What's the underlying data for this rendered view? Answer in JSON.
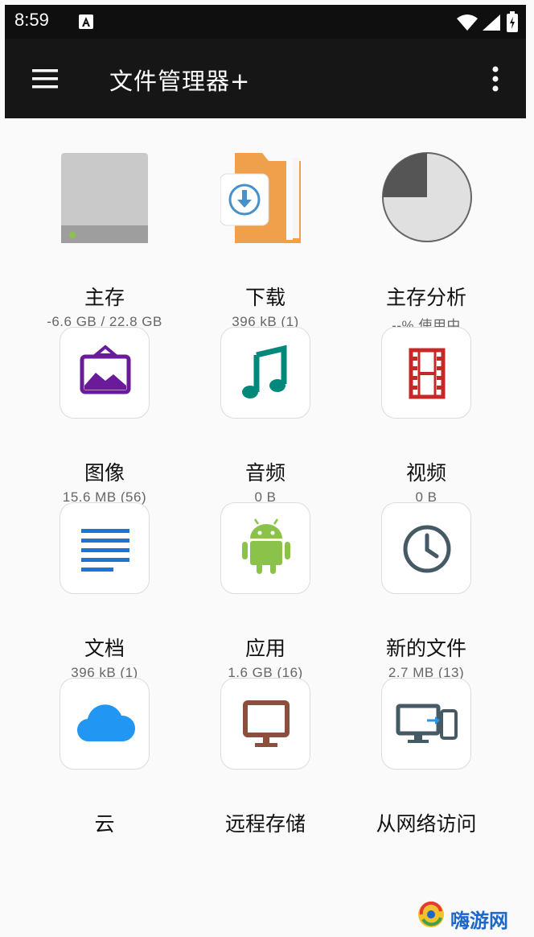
{
  "status_bar": {
    "time": "8:59"
  },
  "app_bar": {
    "title": "文件管理器+"
  },
  "items": [
    {
      "label": "主存",
      "sub": "-6.6 GB / 22.8 GB",
      "icon": "hard-drive-icon"
    },
    {
      "label": "下载",
      "sub": "396 kB (1)",
      "icon": "download-folder-icon"
    },
    {
      "label": "主存分析",
      "sub": "--% 使用中",
      "icon": "pie-chart-icon"
    },
    {
      "label": "图像",
      "sub": "15.6 MB (56)",
      "icon": "image-icon"
    },
    {
      "label": "音频",
      "sub": "0 B",
      "icon": "music-note-icon"
    },
    {
      "label": "视频",
      "sub": "0 B",
      "icon": "film-icon"
    },
    {
      "label": "文档",
      "sub": "396 kB (1)",
      "icon": "document-icon"
    },
    {
      "label": "应用",
      "sub": "1.6 GB (16)",
      "icon": "android-icon"
    },
    {
      "label": "新的文件",
      "sub": "2.7 MB (13)",
      "icon": "clock-icon"
    },
    {
      "label": "云",
      "sub": "",
      "icon": "cloud-icon"
    },
    {
      "label": "远程存储",
      "sub": "",
      "icon": "monitor-icon"
    },
    {
      "label": "从网络访问",
      "sub": "",
      "icon": "devices-icon"
    }
  ],
  "watermark": {
    "text": "嗨游网"
  },
  "colors": {
    "app_bar": "#161616",
    "folder_orange": "#f0a04b",
    "download_blue": "#4a90c8",
    "image_purple": "#6a1b9a",
    "music_teal": "#00897b",
    "film_red": "#c62828",
    "doc_blue": "#1976d2",
    "android_green": "#8bc34a",
    "clock_slate": "#455a64",
    "cloud_blue": "#2196f3",
    "monitor_brown": "#8d4e3c"
  }
}
